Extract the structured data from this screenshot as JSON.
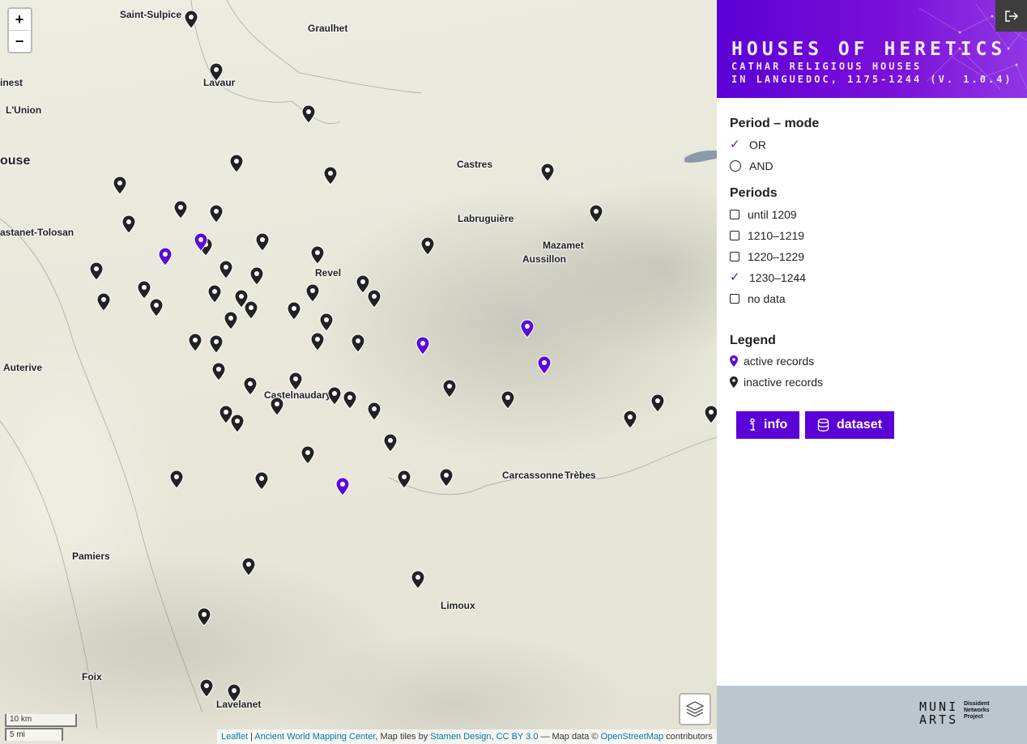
{
  "map": {
    "zoom_in": "+",
    "zoom_out": "−",
    "places": [
      {
        "name": "Saint-Sulpice",
        "big": false
      },
      {
        "name": "Graulhet",
        "big": false
      },
      {
        "name": "Lavaur",
        "big": false
      },
      {
        "name": "inest",
        "big": false
      },
      {
        "name": "L'Union",
        "big": false
      },
      {
        "name": "ouse",
        "big": true
      },
      {
        "name": "Castres",
        "big": false
      },
      {
        "name": "astanet-Tolosan",
        "big": false
      },
      {
        "name": "Labruguière",
        "big": false
      },
      {
        "name": "Mazamet",
        "big": false
      },
      {
        "name": "Aussillon",
        "big": false
      },
      {
        "name": "Revel",
        "big": false
      },
      {
        "name": "Auterive",
        "big": false
      },
      {
        "name": "Castelnaudary",
        "big": false
      },
      {
        "name": "Carcassonne",
        "big": false
      },
      {
        "name": "Trèbes",
        "big": false
      },
      {
        "name": "Pamiers",
        "big": false
      },
      {
        "name": "Limoux",
        "big": false
      },
      {
        "name": "Foix",
        "big": false
      },
      {
        "name": "Lavelanet",
        "big": false
      }
    ],
    "markers_active_count": 6,
    "markers_inactive_count": 70,
    "scale_km": "10 km",
    "scale_mi": "5 mi",
    "attribution": {
      "leaflet": "Leaflet",
      "sep1": " | ",
      "awmc": "Ancient World Mapping Center",
      "tiles": ", Map tiles by ",
      "stamen": "Stamen Design",
      "comma": ", ",
      "cc": "CC BY 3.0",
      "data": " — Map data © ",
      "osm": "OpenStreetMap",
      "contrib": " contributors"
    }
  },
  "panel": {
    "title": "HOUSES OF HERETICS",
    "subtitle_1": "CATHAR RELIGIOUS HOUSES",
    "subtitle_2": "IN LANGUEDOC, 1175-1244 (V. 1.0.4)",
    "mode_heading": "Period – mode",
    "mode_options": [
      {
        "label": "OR",
        "selected": true
      },
      {
        "label": "AND",
        "selected": false
      }
    ],
    "periods_heading": "Periods",
    "periods": [
      {
        "label": "until 1209",
        "checked": false
      },
      {
        "label": "1210–1219",
        "checked": false
      },
      {
        "label": "1220–1229",
        "checked": false
      },
      {
        "label": "1230–1244",
        "checked": true
      },
      {
        "label": "no data",
        "checked": false
      }
    ],
    "legend_heading": "Legend",
    "legend": [
      {
        "label": "active records",
        "color": "#5b0bd6"
      },
      {
        "label": "inactive records",
        "color": "#222222"
      }
    ],
    "info_button": "info",
    "dataset_button": "dataset",
    "footer_logo_1": "MUNI",
    "footer_logo_2": "ARTS",
    "footer_project_1": "Dissident",
    "footer_project_2": "Networks",
    "footer_project_3": "Project"
  },
  "colors": {
    "accent": "#5b00d6",
    "active_marker": "#5b0bd6",
    "inactive_marker": "#222222"
  }
}
